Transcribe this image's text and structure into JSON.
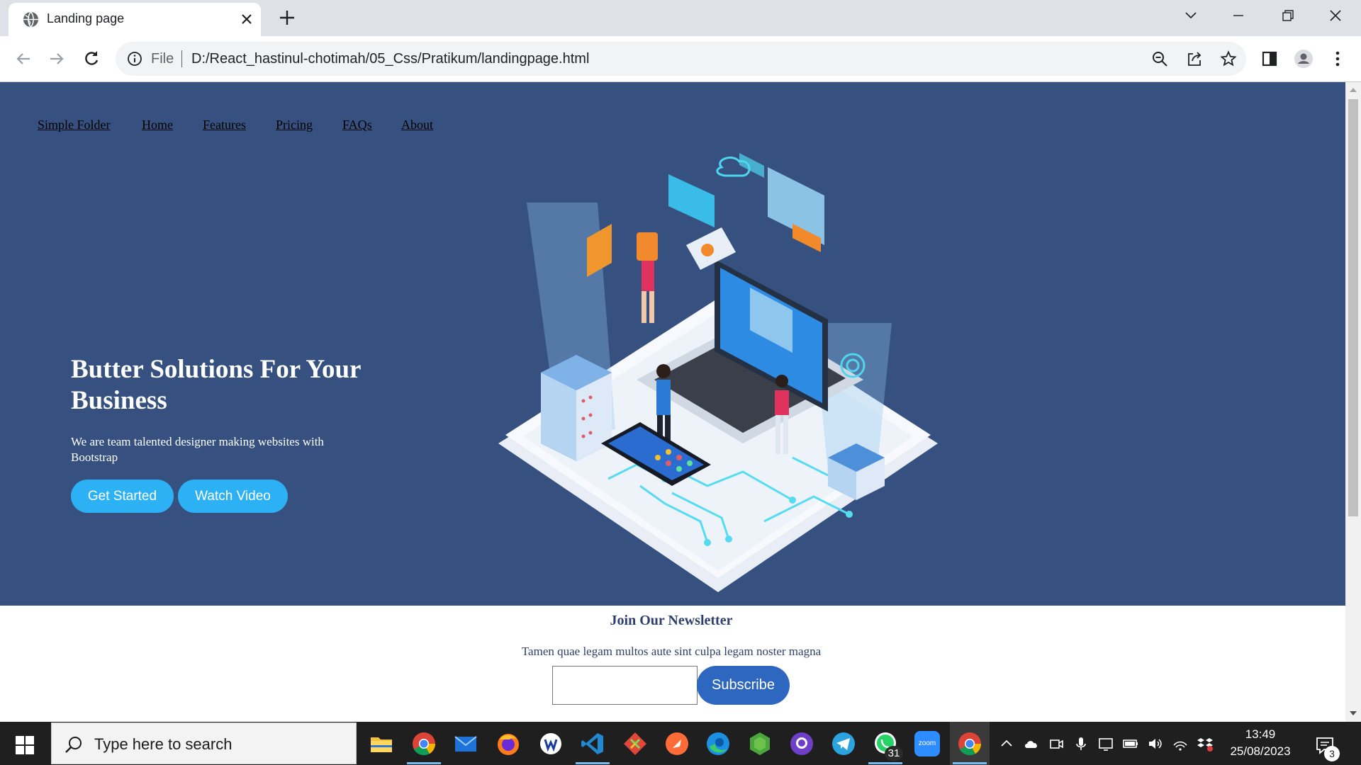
{
  "browser": {
    "tab_title": "Landing page",
    "url_scheme": "File",
    "url": "D:/React_hastinul-chotimah/05_Css/Pratikum/landingpage.html"
  },
  "page": {
    "nav": [
      "Simple Folder",
      "Home",
      "Features",
      "Pricing",
      "FAQs",
      "About"
    ],
    "hero": {
      "title": "Butter Solutions For Your Business",
      "subtitle": "We are team talented designer making websites with Bootstrap",
      "primary_button": "Get Started",
      "secondary_button": "Watch Video"
    },
    "newsletter": {
      "title": "Join Our Newsletter",
      "subtitle": "Tamen quae legam multos aute sint culpa legam noster magna",
      "input_value": "",
      "button": "Subscribe"
    },
    "colors": {
      "hero_bg": "#365180",
      "pill_bg": "#2db1f5",
      "subscribe_bg": "#2d67bf"
    }
  },
  "taskbar": {
    "search_placeholder": "Type here to search",
    "apps": [
      "file-explorer",
      "chrome",
      "mail",
      "firefox",
      "app-w",
      "vscode",
      "git",
      "postman",
      "edge",
      "nodejs",
      "github-desktop",
      "telegram",
      "whatsapp",
      "zoom",
      "chrome-active"
    ],
    "whatsapp_badge": "31",
    "zoom_label": "zoom",
    "time": "13:49",
    "date": "25/08/2023",
    "notification_count": "3"
  }
}
